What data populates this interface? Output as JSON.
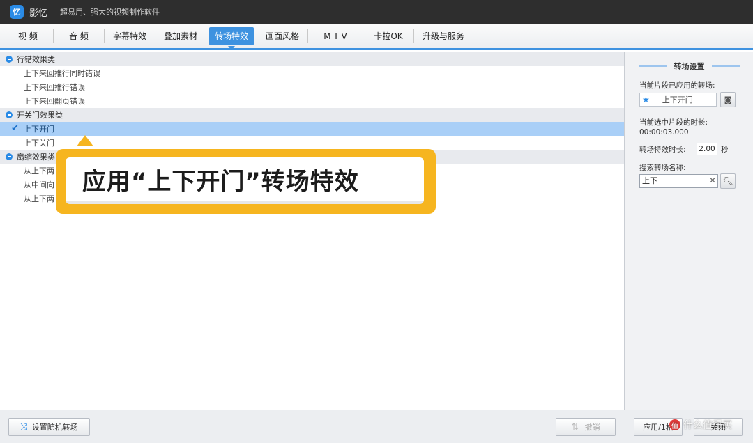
{
  "app": {
    "logo_glyph": "忆",
    "name": "影忆",
    "slogan": "超易用、强大的视频制作软件"
  },
  "tabs": [
    {
      "label": "视 频",
      "active": false
    },
    {
      "label": "音 频",
      "active": false
    },
    {
      "label": "字幕特效",
      "active": false
    },
    {
      "label": "叠加素材",
      "active": false
    },
    {
      "label": "转场特效",
      "active": true
    },
    {
      "label": "画面风格",
      "active": false
    },
    {
      "label": "M T V",
      "active": false
    },
    {
      "label": "卡拉OK",
      "active": false
    },
    {
      "label": "升级与服务",
      "active": false
    }
  ],
  "categories": [
    {
      "name": "行错效果类",
      "items": [
        "上下来回推行同时错误",
        "上下来回推行错误",
        "上下来回翻页错误"
      ]
    },
    {
      "name": "开关门效果类",
      "items": [
        "上下开门",
        "上下关门"
      ],
      "selected_index": 0
    },
    {
      "name": "扇缩效果类",
      "items": [
        "从上下两",
        "从中间向",
        "从上下两"
      ]
    }
  ],
  "settings": {
    "title": "转场设置",
    "applied_label": "当前片段已应用的转场:",
    "applied_value": "上下开门",
    "selected_duration_label": "当前选中片段的时长:",
    "selected_duration_value": "00:00:03.000",
    "effect_duration_label": "转场特效时长:",
    "effect_duration_value": "2.00",
    "effect_duration_unit": "秒",
    "search_label": "搜索转场名称:",
    "search_value": "上下"
  },
  "bottom": {
    "random_label": "设置随机转场",
    "undo_label": "撤销",
    "apply_all_label": "应用/1格",
    "close_label": "关闭"
  },
  "callout": {
    "text": "应用“上下开门”转场特效"
  },
  "watermark": {
    "text": "什么值得买",
    "logo_glyph": "值"
  },
  "colors": {
    "accent": "#3e92e0",
    "selection": "#a9cff7",
    "callout": "#f6b51f"
  }
}
